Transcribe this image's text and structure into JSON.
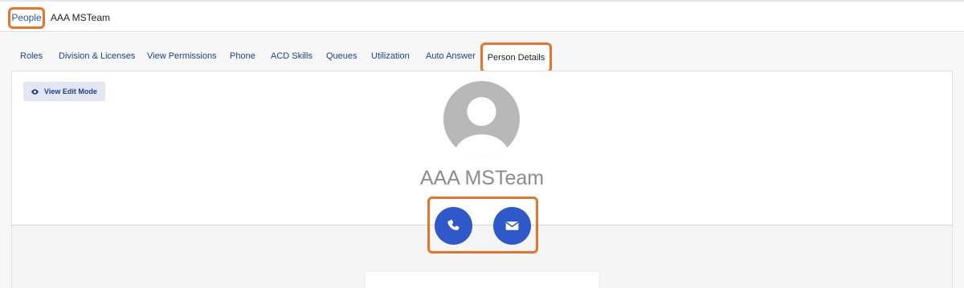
{
  "breadcrumb": {
    "root_label": "People",
    "current_label": "AAA MSTeam"
  },
  "tabs": [
    {
      "label": "Roles"
    },
    {
      "label": "Division & Licenses"
    },
    {
      "label": "View Permissions"
    },
    {
      "label": "Phone"
    },
    {
      "label": "ACD Skills"
    },
    {
      "label": "Queues"
    },
    {
      "label": "Utilization"
    },
    {
      "label": "Auto Answer"
    },
    {
      "label": "Person Details",
      "active": true
    }
  ],
  "toolbar": {
    "view_edit_label": "View Edit Mode",
    "view_edit_icon": "eye-icon"
  },
  "person": {
    "name": "AAA MSTeam",
    "avatar_icon": "default-avatar-icon"
  },
  "actions": {
    "call_icon": "phone-icon",
    "email_icon": "envelope-icon"
  },
  "colors": {
    "accent": "#2f59c8",
    "link": "#1d3f8f",
    "highlight": "#e8742a"
  }
}
